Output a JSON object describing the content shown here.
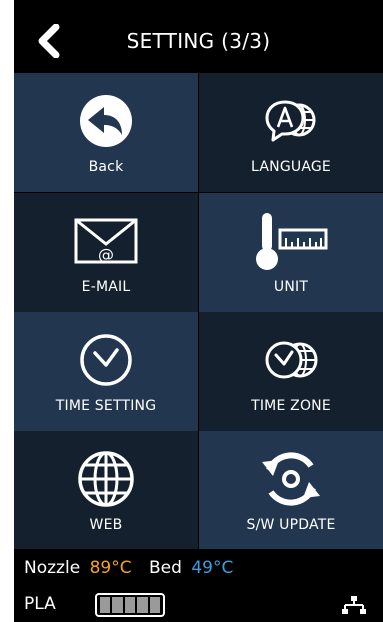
{
  "header": {
    "title": "SETTING (3/3)",
    "back_icon": "chevron-left-icon"
  },
  "tiles": [
    {
      "label": "Back",
      "icon": "back-arrow-icon"
    },
    {
      "label": "LANGUAGE",
      "icon": "language-globe-icon"
    },
    {
      "label": "E-MAIL",
      "icon": "email-envelope-icon"
    },
    {
      "label": "UNIT",
      "icon": "thermometer-ruler-icon"
    },
    {
      "label": "TIME SETTING",
      "icon": "clock-icon"
    },
    {
      "label": "TIME ZONE",
      "icon": "clock-globe-icon"
    },
    {
      "label": "WEB",
      "icon": "globe-icon"
    },
    {
      "label": "S/W UPDATE",
      "icon": "update-sync-icon"
    }
  ],
  "status": {
    "nozzle_label": "Nozzle",
    "nozzle_temp": "89°C",
    "bed_label": "Bed",
    "bed_temp": "49°C",
    "material": "PLA",
    "filament_segments": 5,
    "network_icon": "network-icon"
  },
  "colors": {
    "nozzle_temp": "#f6a31c",
    "bed_temp": "#3a9ee0",
    "tile_dark": "#14202d",
    "tile_light": "#233650"
  }
}
